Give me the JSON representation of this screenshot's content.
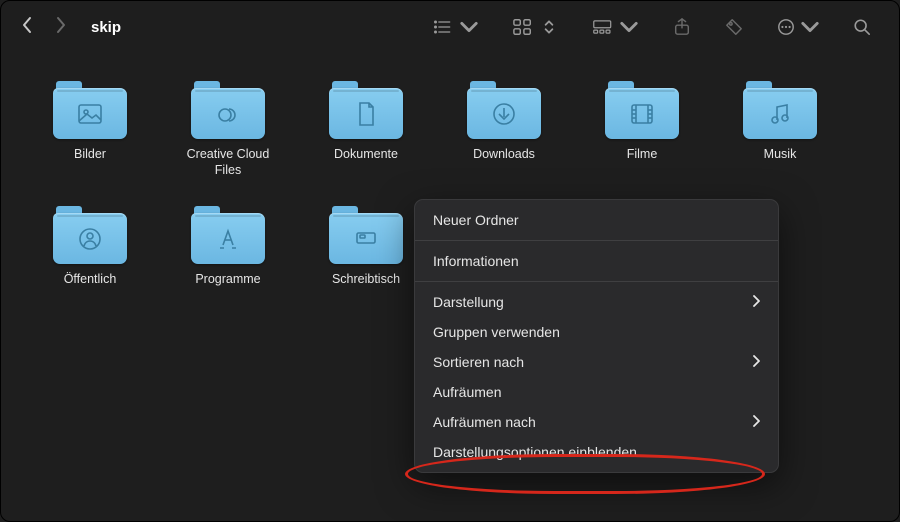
{
  "window": {
    "title": "skip"
  },
  "folders": [
    {
      "name": "Bilder",
      "glyph": "picture"
    },
    {
      "name": "Creative Cloud Files",
      "glyph": "creative-cloud"
    },
    {
      "name": "Dokumente",
      "glyph": "document"
    },
    {
      "name": "Downloads",
      "glyph": "download"
    },
    {
      "name": "Filme",
      "glyph": "film"
    },
    {
      "name": "Musik",
      "glyph": "music"
    },
    {
      "name": "Öffentlich",
      "glyph": "public"
    },
    {
      "name": "Programme",
      "glyph": "applications"
    },
    {
      "name": "Schreibtisch",
      "glyph": "desktop"
    }
  ],
  "context_menu": {
    "sections": [
      [
        {
          "label": "Neuer Ordner",
          "submenu": false
        }
      ],
      [
        {
          "label": "Informationen",
          "submenu": false
        }
      ],
      [
        {
          "label": "Darstellung",
          "submenu": true
        },
        {
          "label": "Gruppen verwenden",
          "submenu": false
        },
        {
          "label": "Sortieren nach",
          "submenu": true
        },
        {
          "label": "Aufräumen",
          "submenu": false
        },
        {
          "label": "Aufräumen nach",
          "submenu": true
        },
        {
          "label": "Darstellungsoptionen einblenden",
          "submenu": false
        }
      ]
    ]
  },
  "annotation": {
    "highlight_label": "Darstellungsoptionen einblenden"
  }
}
